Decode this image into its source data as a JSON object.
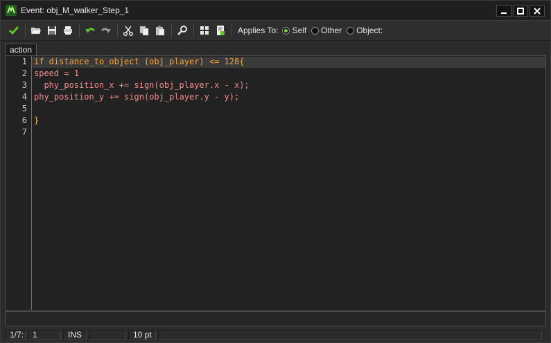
{
  "window": {
    "title": "Event: obj_M_walker_Step_1"
  },
  "toolbar": {
    "applies_label": "Applies To:",
    "options": [
      {
        "label": "Self",
        "checked": true
      },
      {
        "label": "Other",
        "checked": false
      },
      {
        "label": "Object:",
        "checked": false
      }
    ]
  },
  "tab": {
    "label": "action"
  },
  "editor": {
    "line_numbers": [
      "1",
      "2",
      "3",
      "4",
      "5",
      "6",
      "7"
    ],
    "lines": [
      "if distance_to_object (obj_player) <= 128{",
      "speed = 1",
      "  phy_position_x += sign(obj_player.x - x);",
      "phy_position_y += sign(obj_player.y - y);",
      "",
      "}",
      ""
    ]
  },
  "status": {
    "position": "1/7:",
    "column": "1",
    "mode": "INS",
    "blank": "",
    "font_size": "10 pt"
  },
  "colors": {
    "accent": "#7fd23a",
    "background": "#222222"
  }
}
